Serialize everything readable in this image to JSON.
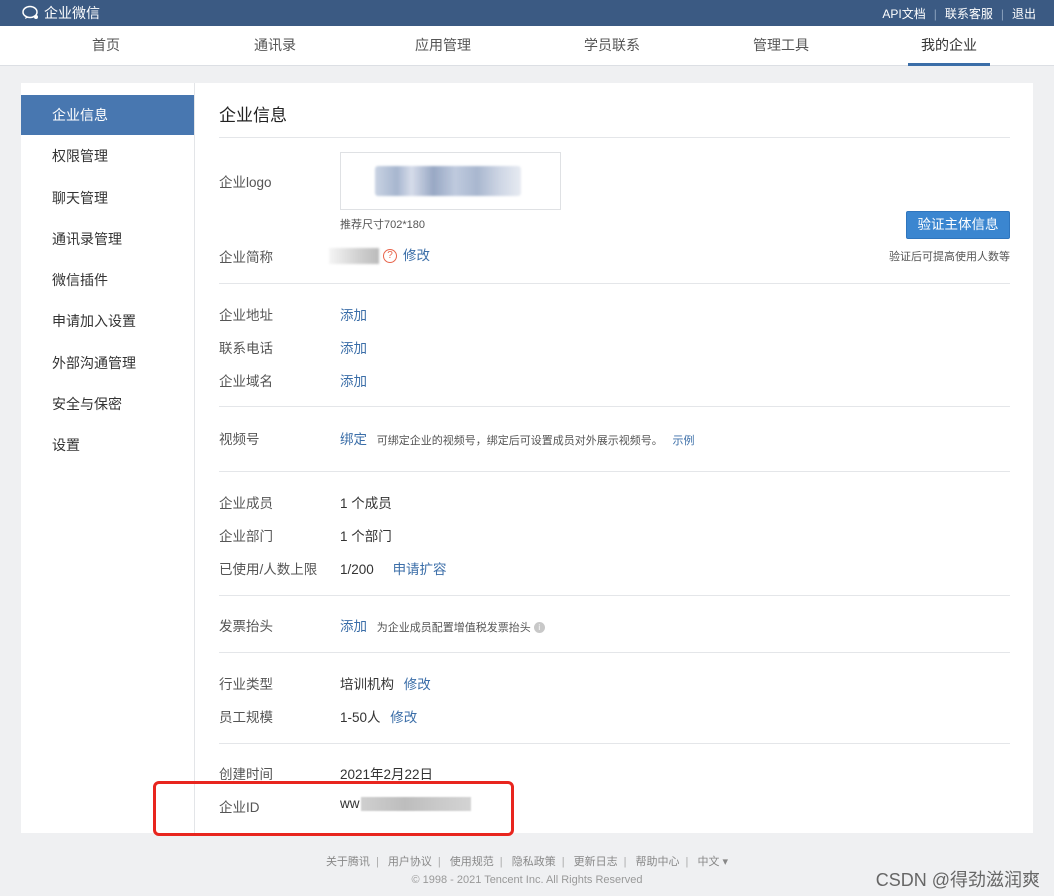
{
  "topbar": {
    "brand": "企业微信",
    "links": [
      "API文档",
      "联系客服",
      "退出"
    ]
  },
  "nav": {
    "items": [
      "首页",
      "通讯录",
      "应用管理",
      "学员联系",
      "管理工具",
      "我的企业"
    ],
    "active": "我的企业"
  },
  "sidebar": {
    "items": [
      "企业信息",
      "权限管理",
      "聊天管理",
      "通讯录管理",
      "微信插件",
      "申请加入设置",
      "外部沟通管理",
      "安全与保密",
      "设置"
    ],
    "active": "企业信息"
  },
  "main": {
    "title": "企业信息",
    "logo": {
      "label": "企业logo",
      "hint": "推荐尺寸702*180"
    },
    "short_name": {
      "label": "企业简称",
      "edit": "修改",
      "help_icon": "?"
    },
    "verify": {
      "button": "验证主体信息",
      "hint": "验证后可提高使用人数等"
    },
    "address": {
      "label": "企业地址",
      "action": "添加"
    },
    "phone": {
      "label": "联系电话",
      "action": "添加"
    },
    "domain": {
      "label": "企业域名",
      "action": "添加"
    },
    "video": {
      "label": "视频号",
      "action": "绑定",
      "hint": "可绑定企业的视频号，绑定后可设置成员对外展示视频号。",
      "example": "示例"
    },
    "members": {
      "label": "企业成员",
      "value": "1 个成员"
    },
    "departments": {
      "label": "企业部门",
      "value": "1 个部门"
    },
    "limit": {
      "label": "已使用/人数上限",
      "value": "1/200",
      "action": "申请扩容"
    },
    "invoice": {
      "label": "发票抬头",
      "action": "添加",
      "hint": "为企业成员配置增值税发票抬头",
      "info_icon": "i"
    },
    "industry": {
      "label": "行业类型",
      "value": "培训机构",
      "edit": "修改"
    },
    "scale": {
      "label": "员工规模",
      "value": "1-50人",
      "edit": "修改"
    },
    "created": {
      "label": "创建时间",
      "value": "2021年2月22日"
    },
    "corp_id": {
      "label": "企业ID",
      "value_prefix": "ww"
    }
  },
  "footer": {
    "links": [
      "关于腾讯",
      "用户协议",
      "使用规范",
      "隐私政策",
      "更新日志",
      "帮助中心",
      "中文 ▾"
    ],
    "copyright": "© 1998 - 2021 Tencent Inc. All Rights Reserved"
  },
  "watermark": "CSDN @得劲滋润爽",
  "colors": {
    "topbar": "#3b5a83",
    "accent": "#4877b0",
    "link": "#3b6ea8",
    "button": "#3b86d0",
    "highlight": "#e8251e"
  }
}
